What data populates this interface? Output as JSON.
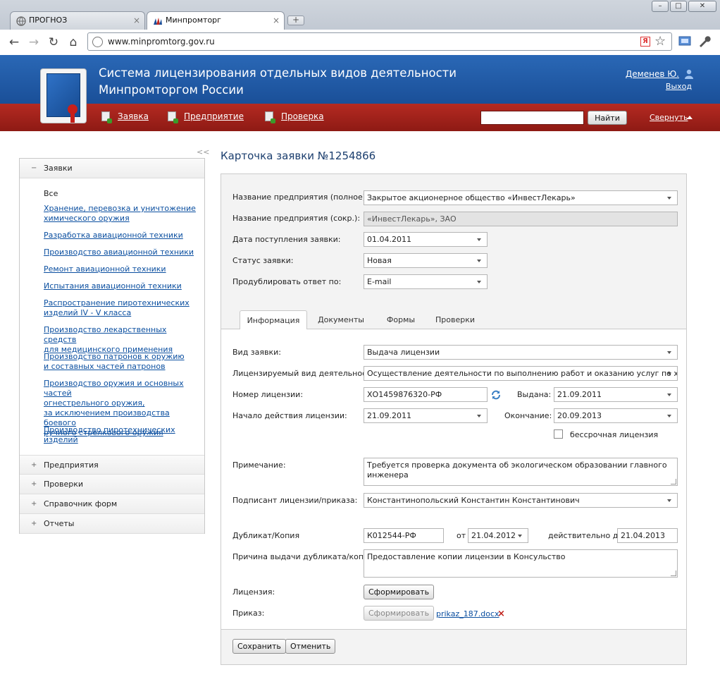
{
  "browser": {
    "tabs": [
      {
        "label": "ПРОГНОЗ",
        "active": false
      },
      {
        "label": "Минпромторг",
        "active": true
      }
    ],
    "url": "www.minpromtorg.gov.ru"
  },
  "header": {
    "title_line1": "Система лицензирования отдельных видов деятельности",
    "title_line2": "Минпромторгом России",
    "user": "Деменев Ю.",
    "logout": "Выход",
    "menu": [
      "Заявка",
      "Предприятие",
      "Проверка"
    ],
    "search_button": "Найти",
    "collapse": "Свернуть"
  },
  "sidebar": {
    "toggle": "<<",
    "sections": [
      {
        "label": "Заявки",
        "expanded": true
      },
      {
        "label": "Предприятия",
        "expanded": false
      },
      {
        "label": "Проверки",
        "expanded": false
      },
      {
        "label": "Справочник форм",
        "expanded": false
      },
      {
        "label": "Отчеты",
        "expanded": false
      }
    ],
    "all": "Все",
    "links": [
      [
        "Хранение, перевозка и уничтожение",
        "химического оружия"
      ],
      [
        "Разработка авиационной техники"
      ],
      [
        "Производство авиационной техники"
      ],
      [
        "Ремонт авиационной техники"
      ],
      [
        "Испытания авиационной техники"
      ],
      [
        "Распространение пиротехнических",
        "изделий IV - V класса"
      ],
      [
        "Производство лекарственных средств",
        "для медицинского применения"
      ],
      [
        "Производство патронов к оружию",
        "и составных частей патронов"
      ],
      [
        "Производство оружия и основных частей",
        "огнестрельного оружия,",
        "за исключением производства боевого",
        "ручного стрелкового оружия"
      ],
      [
        "Производство пиротехнических изделий"
      ]
    ]
  },
  "card": {
    "title": "Карточка заявки №1254866",
    "top_fields": [
      {
        "label": "Название предприятия (полное):",
        "value": "Закрытое акционерное общество «ИнвестЛекарь»"
      },
      {
        "label": "Название предприятия (сокр.):",
        "value": "«ИнвестЛекарь», ЗАО"
      },
      {
        "label": "Дата поступления заявки:",
        "value": "01.04.2011"
      },
      {
        "label": "Статус заявки:",
        "value": "Новая"
      },
      {
        "label": "Продублировать ответ по:",
        "value": "E-mail"
      }
    ],
    "tabs": [
      "Информация",
      "Документы",
      "Формы",
      "Проверки"
    ],
    "info": {
      "type_label": "Вид заявки:",
      "type_value": "Выдача лицензии",
      "activity_label": "Лицензируемый вид деятельности:",
      "activity_value": "Осуществление деятельности по выполнению работ и оказанию услуг по хранению",
      "number_label": "Номер лицензии:",
      "number_value": "ХО1459876320-РФ",
      "issued_label": "Выдана:",
      "issued_value": "21.09.2011",
      "start_label": "Начало действия лицензии:",
      "start_value": "21.09.2011",
      "end_label": "Окончание:",
      "end_value": "20.09.2013",
      "perpetual_label": "бессрочная лицензия",
      "note_label": "Примечание:",
      "note_value": "Требуется проверка документа об экологическом образовании главного инженера",
      "signer_label": "Подписант лицензии/приказа:",
      "signer_value": "Константинопольский Константин Константинович",
      "dup_label": "Дубликат/Копия",
      "dup_value": "К012544-РФ",
      "from_label": "от",
      "from_value": "21.04.2012",
      "valid_label": "действительно до",
      "valid_value": "21.04.2013",
      "reason_label": "Причина выдачи дубликата/копии:",
      "reason_value": "Предоставление копии лицензии в Консульство",
      "license_label": "Лицензия:",
      "license_button": "Сформировать",
      "order_label": "Приказ:",
      "order_button": "Сформировать",
      "order_file": "prikaz_187.docx"
    },
    "save": "Сохранить",
    "cancel": "Отменить"
  }
}
